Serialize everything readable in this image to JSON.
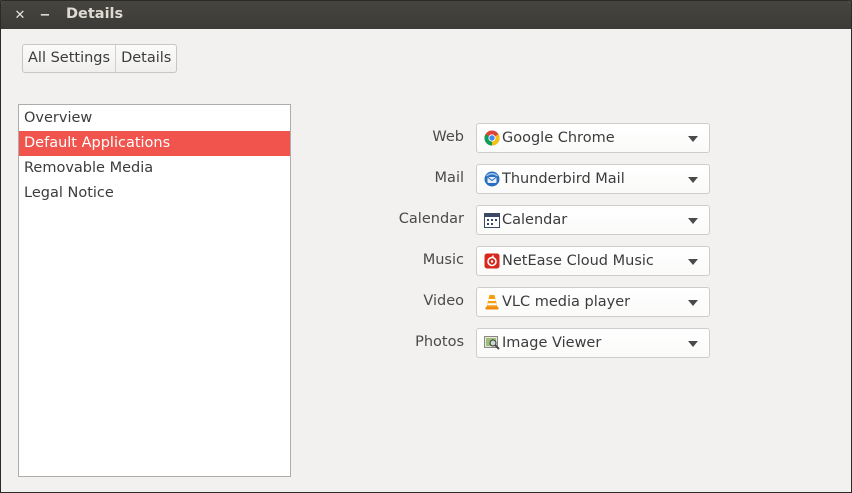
{
  "window": {
    "title": "Details",
    "close_glyph": "✕",
    "minimize_glyph": "−"
  },
  "breadcrumb": [
    "All Settings",
    "Details"
  ],
  "sidebar": {
    "items": [
      {
        "label": "Overview",
        "selected": false
      },
      {
        "label": "Default Applications",
        "selected": true
      },
      {
        "label": "Removable Media",
        "selected": false
      },
      {
        "label": "Legal Notice",
        "selected": false
      }
    ]
  },
  "defaults": [
    {
      "label": "Web",
      "value": "Google Chrome",
      "icon": "chrome-icon"
    },
    {
      "label": "Mail",
      "value": "Thunderbird Mail",
      "icon": "thunderbird-icon"
    },
    {
      "label": "Calendar",
      "value": "Calendar",
      "icon": "calendar-icon"
    },
    {
      "label": "Music",
      "value": "NetEase Cloud Music",
      "icon": "netease-music-icon"
    },
    {
      "label": "Video",
      "value": "VLC media player",
      "icon": "vlc-icon"
    },
    {
      "label": "Photos",
      "value": "Image Viewer",
      "icon": "image-viewer-icon"
    }
  ],
  "colors": {
    "selection": "#f0544c",
    "titlebar": "#3c3b37"
  }
}
